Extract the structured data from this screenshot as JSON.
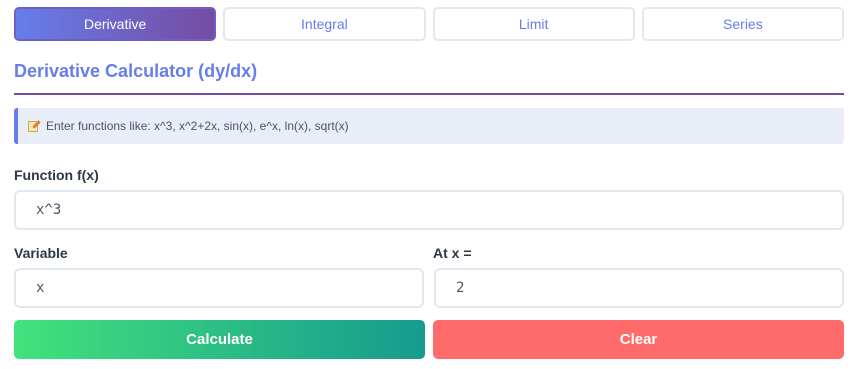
{
  "tabs": [
    {
      "label": "Derivative",
      "active": true
    },
    {
      "label": "Integral",
      "active": false
    },
    {
      "label": "Limit",
      "active": false
    },
    {
      "label": "Series",
      "active": false
    }
  ],
  "header": {
    "title": "Derivative Calculator (dy/dx)"
  },
  "info": {
    "icon": "memo-icon",
    "text": "Enter functions like: x^3, x^2+2x, sin(x), e^x, ln(x), sqrt(x)"
  },
  "form": {
    "function_label": "Function f(x)",
    "function_value": "x^3",
    "variable_label": "Variable",
    "variable_value": "x",
    "at_x_label": "At x =",
    "at_x_value": "2"
  },
  "buttons": {
    "calculate": "Calculate",
    "clear": "Clear"
  },
  "colors": {
    "accent": "#667eea",
    "accent_dark": "#764ba2",
    "clear": "#ff6b6b",
    "calc_start": "#42e27b",
    "calc_end": "#169b8e"
  }
}
